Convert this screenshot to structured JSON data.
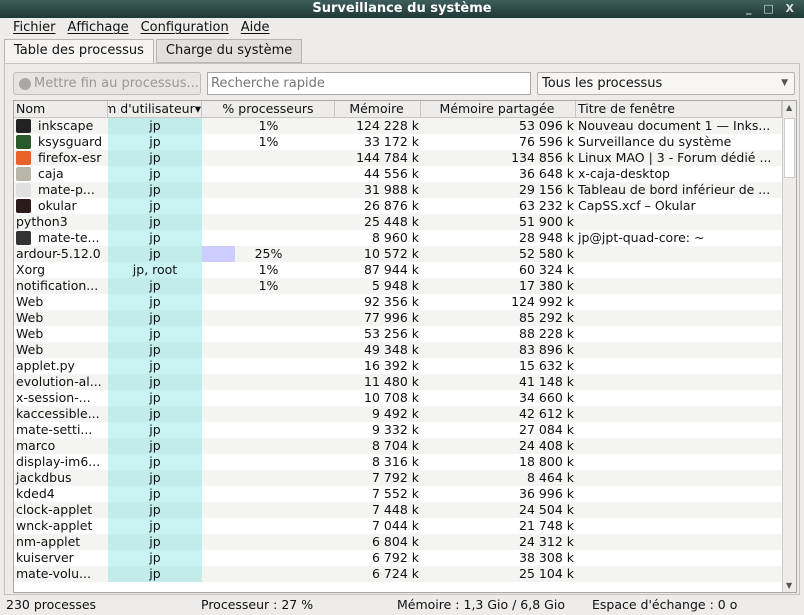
{
  "window": {
    "title": "Surveillance du système",
    "controls": "_ □ X"
  },
  "menu": [
    "Fichier",
    "Affichage",
    "Configuration",
    "Aide"
  ],
  "tabs": [
    "Table des processus",
    "Charge du système"
  ],
  "toolbar": {
    "kill_label": "Mettre fin au processus...",
    "search_placeholder": "Recherche rapide",
    "filter_value": "Tous les processus"
  },
  "columns": [
    "Nom",
    "Nom d'utilisateur",
    "% processeurs",
    "Mémoire",
    "Mémoire partagée",
    "Titre de fenêtre"
  ],
  "rows": [
    {
      "name": "inkscape",
      "icon": "inkscape-icon",
      "color": "#222",
      "user": "jp",
      "cpu": "1%",
      "cpu_pct": 0,
      "mem": "124 228 k",
      "shared": "53 096 k",
      "title": "Nouveau document 1 — Inks..."
    },
    {
      "name": "ksysguard",
      "icon": "ksysguard-icon",
      "color": "#2a5a2a",
      "user": "jp",
      "cpu": "1%",
      "cpu_pct": 0,
      "mem": "33 172 k",
      "shared": "76 596 k",
      "title": "Surveillance du système"
    },
    {
      "name": "firefox-esr",
      "icon": "firefox-icon",
      "color": "#e8622a",
      "user": "jp",
      "cpu": "",
      "cpu_pct": 0,
      "mem": "144 784 k",
      "shared": "134 856 k",
      "title": "Linux MAO | 3 - Forum dédié ..."
    },
    {
      "name": "caja",
      "icon": "folder-icon",
      "color": "#b8b6a8",
      "user": "jp",
      "cpu": "",
      "cpu_pct": 0,
      "mem": "44 556 k",
      "shared": "36 648 k",
      "title": "x-caja-desktop"
    },
    {
      "name": "mate-p...",
      "icon": "panel-icon",
      "color": "#e0e0e0",
      "user": "jp",
      "cpu": "",
      "cpu_pct": 0,
      "mem": "31 988 k",
      "shared": "29 156 k",
      "title": "Tableau de bord inférieur de ..."
    },
    {
      "name": "okular",
      "icon": "okular-icon",
      "color": "#2a1a1a",
      "user": "jp",
      "cpu": "",
      "cpu_pct": 0,
      "mem": "26 876 k",
      "shared": "63 232 k",
      "title": "CapSS.xcf – Okular"
    },
    {
      "name": "python3",
      "icon": "",
      "color": "",
      "user": "jp",
      "cpu": "",
      "cpu_pct": 0,
      "mem": "25 448 k",
      "shared": "51 900 k",
      "title": ""
    },
    {
      "name": "mate-te...",
      "icon": "terminal-icon",
      "color": "#333",
      "user": "jp",
      "cpu": "",
      "cpu_pct": 0,
      "mem": "8 960 k",
      "shared": "28 948 k",
      "title": "jp@jpt-quad-core: ~"
    },
    {
      "name": "ardour-5.12.0",
      "icon": "",
      "color": "",
      "user": "jp",
      "cpu": "25%",
      "cpu_pct": 25,
      "mem": "10 572 k",
      "shared": "52 580 k",
      "title": ""
    },
    {
      "name": "Xorg",
      "icon": "",
      "color": "",
      "user": "jp, root",
      "cpu": "1%",
      "cpu_pct": 0,
      "mem": "87 944 k",
      "shared": "60 324 k",
      "title": ""
    },
    {
      "name": "notification...",
      "icon": "",
      "color": "",
      "user": "jp",
      "cpu": "1%",
      "cpu_pct": 0,
      "mem": "5 948 k",
      "shared": "17 380 k",
      "title": ""
    },
    {
      "name": "Web",
      "icon": "",
      "color": "",
      "user": "jp",
      "cpu": "",
      "cpu_pct": 0,
      "mem": "92 356 k",
      "shared": "124 992 k",
      "title": ""
    },
    {
      "name": "Web",
      "icon": "",
      "color": "",
      "user": "jp",
      "cpu": "",
      "cpu_pct": 0,
      "mem": "77 996 k",
      "shared": "85 292 k",
      "title": ""
    },
    {
      "name": "Web",
      "icon": "",
      "color": "",
      "user": "jp",
      "cpu": "",
      "cpu_pct": 0,
      "mem": "53 256 k",
      "shared": "88 228 k",
      "title": ""
    },
    {
      "name": "Web",
      "icon": "",
      "color": "",
      "user": "jp",
      "cpu": "",
      "cpu_pct": 0,
      "mem": "49 348 k",
      "shared": "83 896 k",
      "title": ""
    },
    {
      "name": "applet.py",
      "icon": "",
      "color": "",
      "user": "jp",
      "cpu": "",
      "cpu_pct": 0,
      "mem": "16 392 k",
      "shared": "15 632 k",
      "title": ""
    },
    {
      "name": "evolution-al...",
      "icon": "",
      "color": "",
      "user": "jp",
      "cpu": "",
      "cpu_pct": 0,
      "mem": "11 480 k",
      "shared": "41 148 k",
      "title": ""
    },
    {
      "name": "x-session-...",
      "icon": "",
      "color": "",
      "user": "jp",
      "cpu": "",
      "cpu_pct": 0,
      "mem": "10 708 k",
      "shared": "34 660 k",
      "title": ""
    },
    {
      "name": "kaccessible...",
      "icon": "",
      "color": "",
      "user": "jp",
      "cpu": "",
      "cpu_pct": 0,
      "mem": "9 492 k",
      "shared": "42 612 k",
      "title": ""
    },
    {
      "name": "mate-setti...",
      "icon": "",
      "color": "",
      "user": "jp",
      "cpu": "",
      "cpu_pct": 0,
      "mem": "9 332 k",
      "shared": "27 084 k",
      "title": ""
    },
    {
      "name": "marco",
      "icon": "",
      "color": "",
      "user": "jp",
      "cpu": "",
      "cpu_pct": 0,
      "mem": "8 704 k",
      "shared": "24 408 k",
      "title": ""
    },
    {
      "name": "display-im6...",
      "icon": "",
      "color": "",
      "user": "jp",
      "cpu": "",
      "cpu_pct": 0,
      "mem": "8 316 k",
      "shared": "18 800 k",
      "title": ""
    },
    {
      "name": "jackdbus",
      "icon": "",
      "color": "",
      "user": "jp",
      "cpu": "",
      "cpu_pct": 0,
      "mem": "7 792 k",
      "shared": "8 464 k",
      "title": ""
    },
    {
      "name": "kded4",
      "icon": "",
      "color": "",
      "user": "jp",
      "cpu": "",
      "cpu_pct": 0,
      "mem": "7 552 k",
      "shared": "36 996 k",
      "title": ""
    },
    {
      "name": "clock-applet",
      "icon": "",
      "color": "",
      "user": "jp",
      "cpu": "",
      "cpu_pct": 0,
      "mem": "7 448 k",
      "shared": "24 504 k",
      "title": ""
    },
    {
      "name": "wnck-applet",
      "icon": "",
      "color": "",
      "user": "jp",
      "cpu": "",
      "cpu_pct": 0,
      "mem": "7 044 k",
      "shared": "21 748 k",
      "title": ""
    },
    {
      "name": "nm-applet",
      "icon": "",
      "color": "",
      "user": "jp",
      "cpu": "",
      "cpu_pct": 0,
      "mem": "6 804 k",
      "shared": "24 312 k",
      "title": ""
    },
    {
      "name": "kuiserver",
      "icon": "",
      "color": "",
      "user": "jp",
      "cpu": "",
      "cpu_pct": 0,
      "mem": "6 792 k",
      "shared": "38 308 k",
      "title": ""
    },
    {
      "name": "mate-volu...",
      "icon": "",
      "color": "",
      "user": "jp",
      "cpu": "",
      "cpu_pct": 0,
      "mem": "6 724 k",
      "shared": "25 104 k",
      "title": ""
    }
  ],
  "status": {
    "processes": "230 processes",
    "cpu": "Processeur : 27 %",
    "memory": "Mémoire : 1,3 Gio / 6,8 Gio",
    "swap": "Espace d'échange : 0 o"
  }
}
